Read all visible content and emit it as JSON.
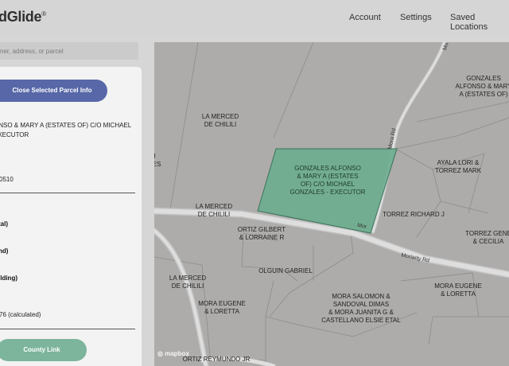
{
  "header": {
    "logo": "dGlide",
    "logo_mark": "®",
    "nav": [
      "Account",
      "Settings",
      "Saved Locations"
    ]
  },
  "search": {
    "placeholder": "ner, address, or parcel"
  },
  "panel": {
    "close_label": "Close Selected Parcel Info",
    "owner_line1": "ONSO & MARY A (ESTATES OF) C/O MICHAEL",
    "owner_line2": "EXECUTOR",
    "parcel_id": "0510",
    "labels": [
      "tal)",
      "nd)",
      "ilding)"
    ],
    "acreage": "76 (calculated)",
    "county_link_label": "County Link"
  },
  "map": {
    "labels": {
      "la_merced_top": "LA MERCED\nDE CHILILI",
      "gonzales_right": "GONZALES\nALFONSO & MARY\nA (ESTATES OF)",
      "selected_parcel": "GONZALES ALFONSO\n& MARY A (ESTATES\nOF) C/O MICHAEL\nGONZALES - EXECUTOR",
      "ayala": "AYALA LORI &\nTORREZ MARK",
      "left_edge": "J\nES",
      "la_merced_mid": "LA MERCED\nDE CHILILI",
      "torrez_richard": "TORREZ RICHARD J",
      "ortiz": "ORTIZ GILBERT\n& LORRAINE R",
      "torrez_gene": "TORREZ GENE\n& CECILIA",
      "olguin": "OLGUIN GABRIEL",
      "la_merced_bottom": "LA MERCED\nDE CHILILI",
      "mora_eugene_right": "MORA EUGENE\n& LORETTA",
      "mora_eugene_left": "MORA EUGENE\n& LORETTA",
      "mora_salomon": "MORA SALOMON &\nSANDOVAL DIMAS\n& MORA JUANITA G &\nCASTELLANO ELSIE ETAL",
      "ortiz_bottom": "ORTIZ REYMUNDO JR"
    },
    "roads": {
      "moriarty": "Moriarty Rd",
      "mora": "Mora Rd",
      "mo_top": "Mo",
      "mor_short": "Mor"
    },
    "attribution": "mapbox",
    "colors": {
      "selected_fill": "#6fae8f",
      "road": "#d9d9d9",
      "background": "#aeacaa"
    }
  }
}
